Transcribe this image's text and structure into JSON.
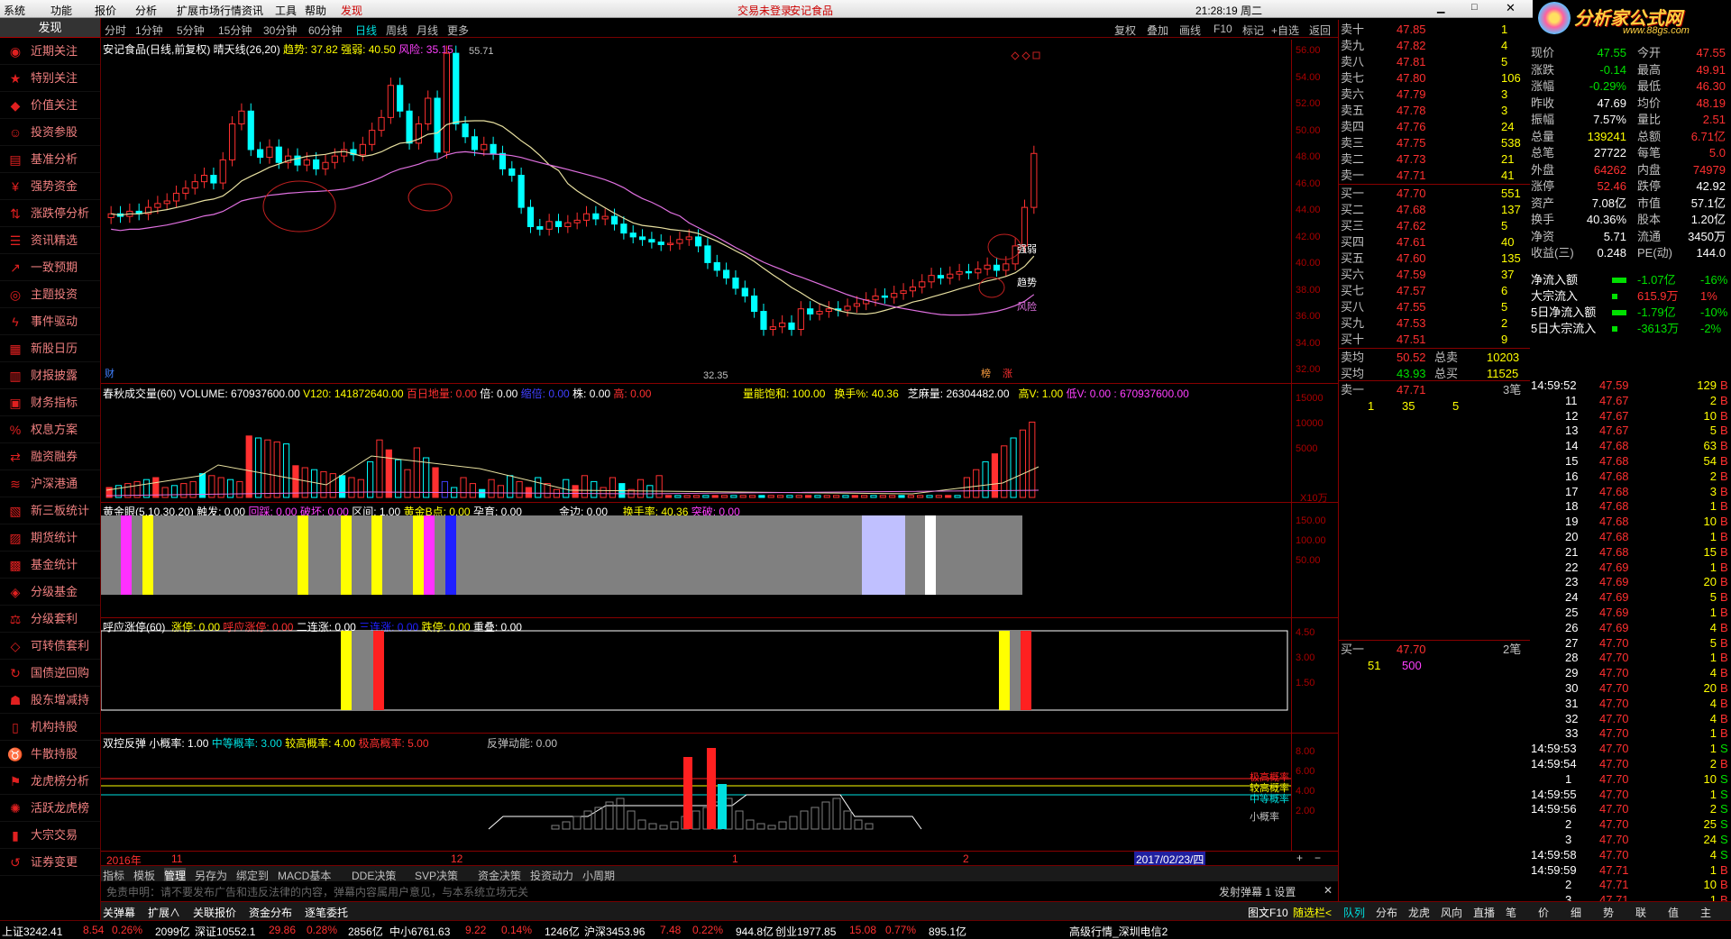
{
  "menu": {
    "items": [
      "系统",
      "功能",
      "报价",
      "分析",
      "扩展市场行情",
      "资讯",
      "工具",
      "帮助",
      "发现"
    ],
    "center_status": "交易未登录",
    "stock_name": "安记食品",
    "clock": "21:28:19 周二"
  },
  "logo": {
    "line1": "分析家公式网",
    "line2": "www.88gs.com"
  },
  "sidebar": {
    "header": "发现",
    "items": [
      {
        "label": "近期关注",
        "icon": "eye-icon"
      },
      {
        "label": "特别关注",
        "icon": "star-icon"
      },
      {
        "label": "价值关注",
        "icon": "diamond-icon"
      },
      {
        "label": "投资参股",
        "icon": "people-icon"
      },
      {
        "label": "基准分析",
        "icon": "chart-icon"
      },
      {
        "label": "强势资金",
        "icon": "money-icon"
      },
      {
        "label": "涨跌停分析",
        "icon": "arrows-icon"
      },
      {
        "label": "资讯精选",
        "icon": "news-icon"
      },
      {
        "label": "一致预期",
        "icon": "trend-icon"
      },
      {
        "label": "主题投资",
        "icon": "target-icon"
      },
      {
        "label": "事件驱动",
        "icon": "bolt-icon"
      },
      {
        "label": "新股日历",
        "icon": "calendar-icon"
      },
      {
        "label": "财报披露",
        "icon": "report-icon"
      },
      {
        "label": "财务指标",
        "icon": "finance-icon"
      },
      {
        "label": "权息方案",
        "icon": "percent-icon"
      },
      {
        "label": "融资融券",
        "icon": "exchange-icon"
      },
      {
        "label": "沪深港通",
        "icon": "bridge-icon"
      },
      {
        "label": "新三板统计",
        "icon": "stats-icon"
      },
      {
        "label": "期货统计",
        "icon": "futures-icon"
      },
      {
        "label": "基金统计",
        "icon": "fund-icon"
      },
      {
        "label": "分级基金",
        "icon": "tier-icon"
      },
      {
        "label": "分级套利",
        "icon": "arbitrage-icon"
      },
      {
        "label": "可转债套利",
        "icon": "bond-icon"
      },
      {
        "label": "国债逆回购",
        "icon": "repo-icon"
      },
      {
        "label": "股东增减持",
        "icon": "holder-icon"
      },
      {
        "label": "机构持股",
        "icon": "building-icon"
      },
      {
        "label": "牛散持股",
        "icon": "bull-icon"
      },
      {
        "label": "龙虎榜分析",
        "icon": "dragon-icon"
      },
      {
        "label": "活跃龙虎榜",
        "icon": "fire-icon"
      },
      {
        "label": "大宗交易",
        "icon": "block-icon"
      },
      {
        "label": "证券变更",
        "icon": "change-icon"
      }
    ]
  },
  "periods": {
    "items": [
      "分时",
      "1分钟",
      "5分钟",
      "15分钟",
      "30分钟",
      "60分钟",
      "日线",
      "周线",
      "月线",
      "更多"
    ],
    "active": "日线",
    "right": [
      "复权",
      "叠加",
      "画线",
      "F10",
      "标记",
      "+自选",
      "返回"
    ]
  },
  "main_chart": {
    "title": "安记食品(日线,前复权)",
    "indicator": "晴天线(26,20)",
    "trend_label": "趋势: 37.82",
    "strong_label": "强弱: 40.50",
    "risk_label": "风险: 35.15",
    "high_label": "55.71",
    "low_label": "32.35",
    "annot_strong": "强弱",
    "annot_trend": "趋势",
    "annot_risk": "风险",
    "marker_cai": "财",
    "marker_bang": "榜",
    "marker_zhang": "涨",
    "yticks": [
      "56.00",
      "54.00",
      "52.00",
      "50.00",
      "48.00",
      "46.00",
      "44.00",
      "42.00",
      "40.00",
      "38.00",
      "36.00",
      "34.00",
      "32.00"
    ]
  },
  "volume_panel": {
    "title": "春秋成交量(60)",
    "vol": "VOLUME: 670937600.00",
    "v120": "V120: 141872640.00",
    "bai": "百日地量: 0.00",
    "bei": "倍: 0.00",
    "suo": "缩倍: 0.00",
    "zhu": "株: 0.00",
    "gao": "高: 0.00",
    "bao": "量能饱和: 100.00",
    "huan": "换手%: 40.36",
    "zhima": "芝麻量: 26304482.00",
    "gaov": "高V: 1.00",
    "div": "低V: 0.00",
    "last": ": 670937600.00",
    "yticks": [
      "15000",
      "10000",
      "5000"
    ],
    "unit": "X10万"
  },
  "gold_panel": {
    "title": "黄金眼(5,10,30,20)",
    "chufa": "触发: 0.00",
    "huicai": "回踩: 0.00",
    "pohuai": "破坏: 0.00",
    "qujian": "区间: 1.00",
    "jinb": "黄金B点: 0.00",
    "yunyu": "孕育: 0.00",
    "jinbian": "金边: 0.00",
    "huanshou": "换手率: 40.36",
    "tupo": "突破: 0.00",
    "yticks": [
      "150.00",
      "100.00",
      "50.00"
    ]
  },
  "resp_panel": {
    "title": "呼应涨停(60)",
    "zt": "涨停: 0.00",
    "hyzt": "呼应涨停: 0.00",
    "elb": "二连涨: 0.00",
    "slb": "三连涨: 0.00",
    "dt": "跌停: 0.00",
    "cd": "重叠: 0.00",
    "yticks": [
      "4.50",
      "3.00",
      "1.50"
    ]
  },
  "rebound_panel": {
    "title": "双控反弹",
    "small": "小概率: 1.00",
    "mid": "中等概率: 3.00",
    "high": "较高概率: 4.00",
    "ext": "极高概率: 5.00",
    "power": "反弹动能: 0.00",
    "lbl_ext": "极高概率",
    "lbl_high": "较高概率",
    "lbl_mid": "中等概率",
    "lbl_small": "小概率",
    "yticks": [
      "8.00",
      "6.00",
      "4.00",
      "2.00"
    ]
  },
  "date_axis": {
    "y2016": "2016年",
    "m11": "11",
    "m12": "12",
    "m1": "1",
    "m2": "2",
    "current": "2017/02/23/四"
  },
  "bottom_tabs": [
    "指标",
    "模板",
    "管理",
    "另存为",
    "绑定到",
    "MACD基本",
    "DDE决策",
    "SVP决策",
    "资金决策",
    "投资动力",
    "小周期"
  ],
  "tip": "免责申明：请不要发布广告和违反法律的内容，弹幕内容属用户意见，与本系统立场无关",
  "tip_right": "发射弹幕 1   设置",
  "tabstrip": [
    "关弹幕",
    "扩展∧",
    "关联报价",
    "资金分布",
    "逐笔委托"
  ],
  "tabstrip_right": [
    "图文F10",
    "随选栏<"
  ],
  "orderbook": {
    "sell": [
      [
        "卖十",
        "47.85",
        "1"
      ],
      [
        "卖九",
        "47.82",
        "4"
      ],
      [
        "卖八",
        "47.81",
        "5"
      ],
      [
        "卖七",
        "47.80",
        "106"
      ],
      [
        "卖六",
        "47.79",
        "3"
      ],
      [
        "卖五",
        "47.78",
        "3"
      ],
      [
        "卖四",
        "47.76",
        "24"
      ],
      [
        "卖三",
        "47.75",
        "538"
      ],
      [
        "卖二",
        "47.73",
        "21"
      ],
      [
        "卖一",
        "47.71",
        "41"
      ]
    ],
    "buy": [
      [
        "买一",
        "47.70",
        "551"
      ],
      [
        "买二",
        "47.68",
        "137"
      ],
      [
        "买三",
        "47.62",
        "5"
      ],
      [
        "买四",
        "47.61",
        "40"
      ],
      [
        "买五",
        "47.60",
        "135"
      ],
      [
        "买六",
        "47.59",
        "37"
      ],
      [
        "买七",
        "47.57",
        "6"
      ],
      [
        "买八",
        "47.55",
        "5"
      ],
      [
        "买九",
        "47.53",
        "2"
      ],
      [
        "买十",
        "47.51",
        "9"
      ]
    ],
    "sell_avg": [
      "卖均",
      "50.52",
      "总卖",
      "10203"
    ],
    "buy_avg": [
      "买均",
      "43.93",
      "总买",
      "11525"
    ],
    "sell1": [
      "卖一",
      "47.71",
      "3笔"
    ],
    "sell1_q": [
      "1",
      "35",
      "5"
    ],
    "buy1": [
      "买一",
      "47.70",
      "2笔"
    ],
    "buy1_q": [
      "51",
      "500"
    ]
  },
  "quote": [
    [
      "现价",
      "47.55",
      "今开",
      "47.55"
    ],
    [
      "涨跌",
      "-0.14",
      "最高",
      "49.91"
    ],
    [
      "涨幅",
      "-0.29%",
      "最低",
      "46.30"
    ],
    [
      "昨收",
      "47.69",
      "均价",
      "48.19"
    ],
    [
      "振幅",
      "7.57%",
      "量比",
      "2.51"
    ],
    [
      "总量",
      "139241",
      "总额",
      "6.71亿"
    ],
    [
      "总笔",
      "27722",
      "每笔",
      "5.0"
    ],
    [
      "外盘",
      "64262",
      "内盘",
      "74979"
    ],
    [
      "涨停",
      "52.46",
      "跌停",
      "42.92"
    ],
    [
      "资产",
      "7.08亿",
      "市值",
      "57.1亿"
    ],
    [
      "换手",
      "40.36%",
      "股本",
      "1.20亿"
    ],
    [
      "净资",
      "5.71",
      "流通",
      "3450万"
    ],
    [
      "收益(三)",
      "0.248",
      "PE(动)",
      "144.0"
    ]
  ],
  "flows": [
    [
      "净流入额",
      "-1.07亿",
      "-16%"
    ],
    [
      "大宗流入",
      "615.9万",
      "1%"
    ],
    [
      "5日净流入额",
      "-1.79亿",
      "-10%"
    ],
    [
      "5日大宗流入",
      "-3613万",
      "-2%"
    ]
  ],
  "ticks": [
    [
      "14:59:52",
      "47.59",
      "129",
      "B"
    ],
    [
      "11",
      "47.67",
      "2",
      "B"
    ],
    [
      "12",
      "47.67",
      "10",
      "B"
    ],
    [
      "13",
      "47.67",
      "5",
      "B"
    ],
    [
      "14",
      "47.68",
      "63",
      "B"
    ],
    [
      "15",
      "47.68",
      "54",
      "B"
    ],
    [
      "16",
      "47.68",
      "2",
      "B"
    ],
    [
      "17",
      "47.68",
      "3",
      "B"
    ],
    [
      "18",
      "47.68",
      "1",
      "B"
    ],
    [
      "19",
      "47.68",
      "10",
      "B"
    ],
    [
      "20",
      "47.68",
      "1",
      "B"
    ],
    [
      "21",
      "47.68",
      "15",
      "B"
    ],
    [
      "22",
      "47.69",
      "1",
      "B"
    ],
    [
      "23",
      "47.69",
      "20",
      "B"
    ],
    [
      "24",
      "47.69",
      "5",
      "B"
    ],
    [
      "25",
      "47.69",
      "1",
      "B"
    ],
    [
      "26",
      "47.69",
      "4",
      "B"
    ],
    [
      "27",
      "47.70",
      "5",
      "B"
    ],
    [
      "28",
      "47.70",
      "1",
      "B"
    ],
    [
      "29",
      "47.70",
      "4",
      "B"
    ],
    [
      "30",
      "47.70",
      "20",
      "B"
    ],
    [
      "31",
      "47.70",
      "4",
      "B"
    ],
    [
      "32",
      "47.70",
      "4",
      "B"
    ],
    [
      "33",
      "47.70",
      "1",
      "B"
    ],
    [
      "14:59:53",
      "47.70",
      "1",
      "S"
    ],
    [
      "14:59:54",
      "47.70",
      "2",
      "B"
    ],
    [
      "1",
      "47.70",
      "10",
      "S"
    ],
    [
      "14:59:55",
      "47.70",
      "1",
      "S"
    ],
    [
      "14:59:56",
      "47.70",
      "2",
      "S"
    ],
    [
      "2",
      "47.70",
      "25",
      "S"
    ],
    [
      "3",
      "47.70",
      "24",
      "S"
    ],
    [
      "14:59:58",
      "47.70",
      "4",
      "S"
    ],
    [
      "14:59:59",
      "47.71",
      "1",
      "B"
    ],
    [
      "2",
      "47.71",
      "10",
      "B"
    ],
    [
      "3",
      "47.71",
      "1",
      "B"
    ]
  ],
  "right_tabs": [
    "队列",
    "分布",
    "龙虎",
    "风向",
    "直播",
    "笔",
    "价",
    "细",
    "势",
    "联",
    "值",
    "主"
  ],
  "statusbar": {
    "sh": "上证3242.41",
    "sh_chg": "8.54",
    "sh_pct": "0.26%",
    "sh_amt": "2099亿",
    "sz": "深证10552.1",
    "sz_chg": "29.86",
    "sz_pct": "0.28%",
    "sz_amt": "2856亿",
    "zx": "中小6761.63",
    "zx_chg": "9.22",
    "zx_pct": "0.14%",
    "zx_amt": "1246亿",
    "hs": "沪深3453.96",
    "hs_chg": "7.48",
    "hs_pct": "0.22%",
    "hs_amt": "944.8亿",
    "cy": "创业1977.85",
    "cy_chg": "15.08",
    "cy_pct": "0.77%",
    "cy_amt": "895.1亿",
    "server": "高级行情_深圳电信2"
  },
  "colors": {
    "up": "#ff3030",
    "down": "#00e0e0",
    "ma1": "#e8e0a0",
    "ma2": "#e070e0",
    "border": "#880000"
  }
}
